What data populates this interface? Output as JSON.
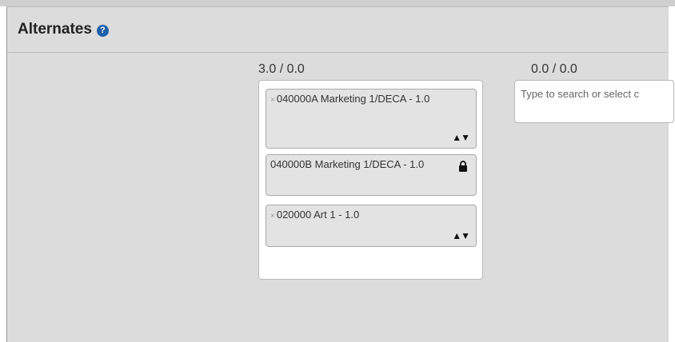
{
  "panel": {
    "title": "Alternates"
  },
  "columns": [
    {
      "total": "3.0 / 0.0",
      "items": [
        {
          "label": "040000A Marketing 1/DECA - 1.0",
          "removable": true,
          "reorder": "▲▼"
        },
        {
          "label": "040000B Marketing 1/DECA - 1.0",
          "locked": true
        },
        {
          "label": "020000 Art 1 - 1.0",
          "removable": true,
          "reorder": "▲▼"
        }
      ]
    },
    {
      "total": "0.0 / 0.0",
      "search_placeholder": "Type to search or select c"
    }
  ],
  "icons": {
    "help": "help-circle-icon",
    "remove": "remove-x-icon",
    "reorder": "up-down-arrows-icon",
    "lock": "lock-icon"
  },
  "colors": {
    "help_icon": "#1f5fa8",
    "panel_bg": "#dcdcdc"
  }
}
